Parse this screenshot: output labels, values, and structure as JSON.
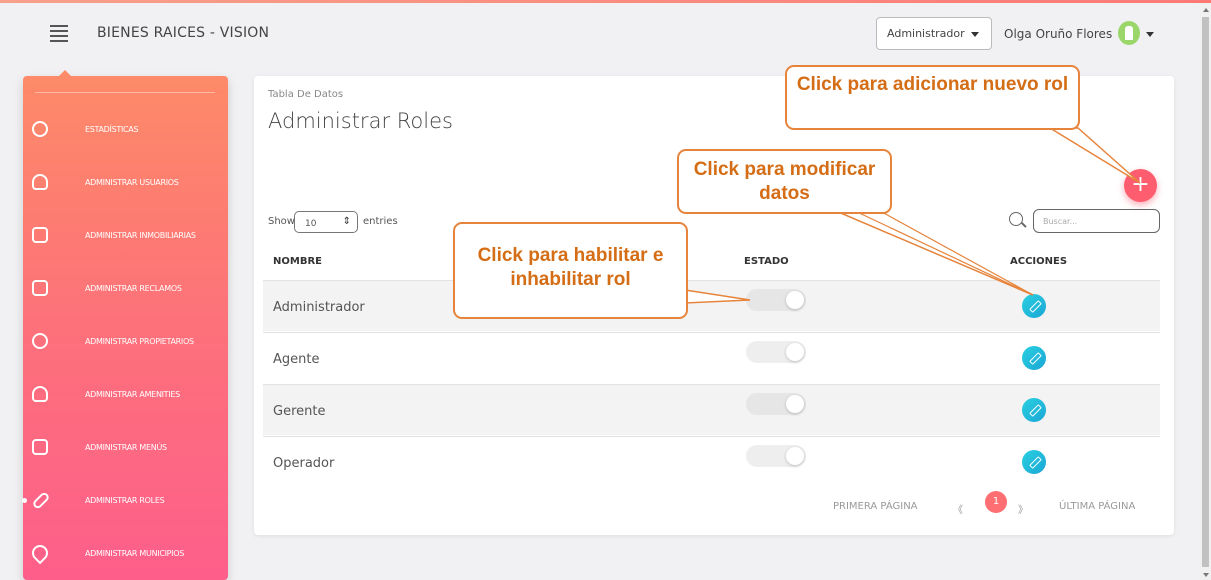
{
  "app": {
    "brand": "BIENES RAICES - VISION",
    "accent_color": "#fd6f7c",
    "edit_color": "#1aa6d6",
    "callout_color": "#d46d15"
  },
  "header": {
    "role_select": "Administrador",
    "user_name": "Olga Oruño Flores",
    "menu_icon": "hamburger-icon",
    "avatar_icon": "user-avatar-icon"
  },
  "sidebar": {
    "items": [
      {
        "label": "ESTADÍSTICAS",
        "icon": "pie-chart-icon"
      },
      {
        "label": "ADMINISTRAR USUARIOS",
        "icon": "user-icon"
      },
      {
        "label": "ADMINISTRAR INMOBILIARIAS",
        "icon": "briefcase-icon"
      },
      {
        "label": "ADMINISTRAR RECLAMOS",
        "icon": "chat-icon"
      },
      {
        "label": "ADMINISTRAR PROPIETARIOS",
        "icon": "key-icon"
      },
      {
        "label": "ADMINISTRAR AMENITIES",
        "icon": "house-icon"
      },
      {
        "label": "ADMINISTRAR MENÚS",
        "icon": "server-icon"
      },
      {
        "label": "ADMINISTRAR ROLES",
        "icon": "link-icon",
        "active": true
      },
      {
        "label": "ADMINISTRAR MUNICIPIOS",
        "icon": "location-pin-icon"
      }
    ]
  },
  "card": {
    "subtitle": "Tabla De Datos",
    "title": "Administrar Roles",
    "add_label": "+",
    "show_label": "Show",
    "entries_value": "10",
    "entries_label": "entries",
    "search_placeholder": "Buscar...",
    "columns": [
      "NOMBRE",
      "ESTADO",
      "ACCIONES"
    ],
    "rows": [
      {
        "name": "Administrador",
        "enabled": false
      },
      {
        "name": "Agente",
        "enabled": false
      },
      {
        "name": "Gerente",
        "enabled": true
      },
      {
        "name": "Operador",
        "enabled": false
      }
    ],
    "pager": {
      "first": "PRIMERA PÁGINA",
      "prev": "《",
      "current": "1",
      "next": "》",
      "last": "ÚLTIMA PÁGINA"
    }
  },
  "callouts": {
    "add": "Click para adicionar nuevo rol",
    "edit": "Click para modificar datos",
    "toggle": "Click para habilitar e inhabilitar rol"
  }
}
